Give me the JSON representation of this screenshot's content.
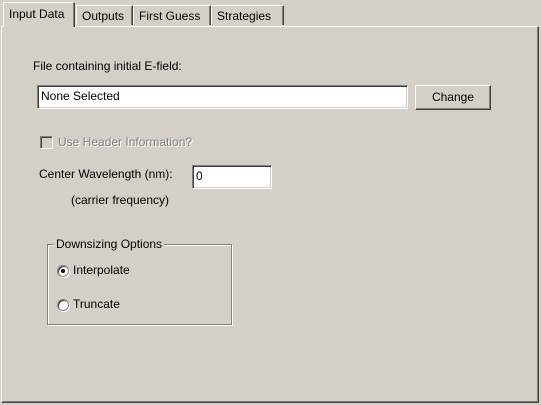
{
  "tabs": [
    {
      "label": "Input Data",
      "active": true
    },
    {
      "label": "Outputs",
      "active": false
    },
    {
      "label": "First Guess",
      "active": false
    },
    {
      "label": "Strategies",
      "active": false
    }
  ],
  "efield": {
    "label": "File containing initial E-field:",
    "value": "None Selected",
    "change_label": "Change"
  },
  "header_info": {
    "label": "Use Header Information?",
    "checked": false,
    "enabled": false
  },
  "wavelength": {
    "label": "Center Wavelength (nm):",
    "value": "0",
    "note": "(carrier frequency)"
  },
  "downsizing": {
    "title": "Downsizing Options",
    "options": [
      {
        "label": "Interpolate",
        "selected": true
      },
      {
        "label": "Truncate",
        "selected": false
      }
    ]
  },
  "colors": {
    "face": "#d4d0c8",
    "shadow": "#808080",
    "highlight": "#ffffff"
  }
}
